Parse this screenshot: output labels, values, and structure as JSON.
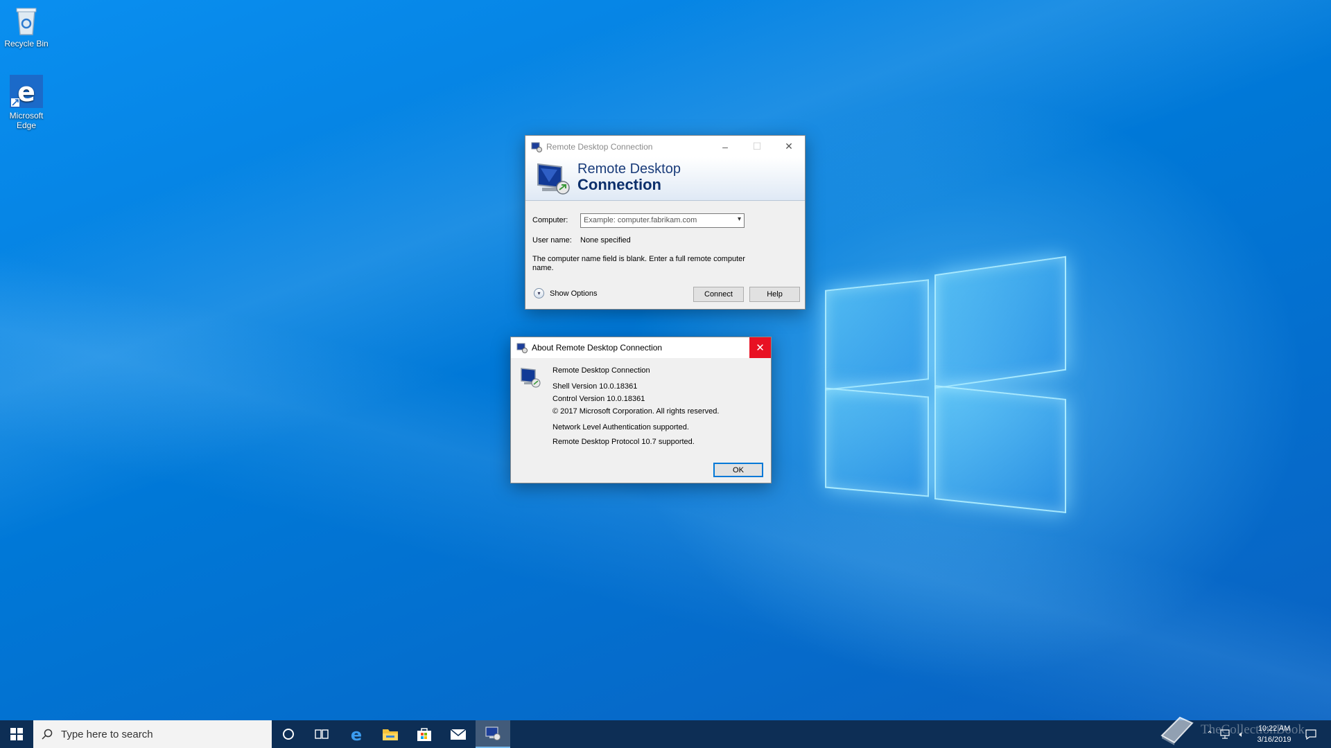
{
  "desktop": {
    "icons": [
      {
        "label": "Recycle Bin"
      },
      {
        "label": "Microsoft Edge"
      }
    ]
  },
  "rdc_window": {
    "title": "Remote Desktop Connection",
    "banner_line1": "Remote Desktop",
    "banner_line2": "Connection",
    "computer_label": "Computer:",
    "computer_placeholder": "Example: computer.fabrikam.com",
    "username_label": "User name:",
    "username_value": "None specified",
    "message": "The computer name field is blank.  Enter a full remote computer name.",
    "show_options": "Show Options",
    "connect_label": "Connect",
    "help_label": "Help"
  },
  "about_dialog": {
    "title": "About Remote Desktop Connection",
    "product": "Remote Desktop Connection",
    "shell_version": "Shell Version 10.0.18361",
    "control_version": "Control Version 10.0.18361",
    "copyright": "© 2017 Microsoft Corporation. All rights reserved.",
    "nla": "Network Level Authentication supported.",
    "protocol": "Remote Desktop Protocol 10.7 supported.",
    "ok_label": "OK"
  },
  "taskbar": {
    "search_placeholder": "Type here to search",
    "clock_time": "10:22 AM",
    "clock_date": "3/16/2019"
  },
  "watermark": "TheCollectionBook",
  "colors": {
    "accent": "#0078d7",
    "close_red": "#e81123",
    "taskbar": "#0d2e55"
  }
}
